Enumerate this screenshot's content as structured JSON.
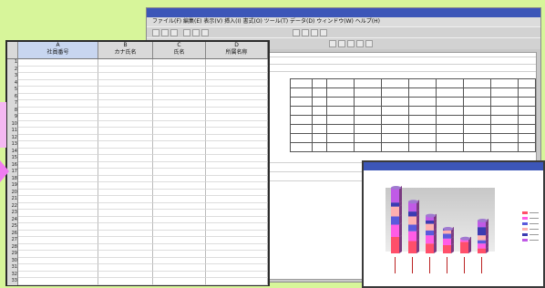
{
  "background_color": "#d7f59a",
  "back_window": {
    "menu_text": "ファイル(F) 編集(E) 表示(V) 挿入(I) 書式(O) ツール(T) データ(D) ウィンドウ(W) ヘルプ(H)"
  },
  "front_sheet": {
    "columns": [
      {
        "letter": "A",
        "header": "社員番号"
      },
      {
        "letter": "B",
        "header": "カナ氏名"
      },
      {
        "letter": "C",
        "header": "氏名"
      },
      {
        "letter": "D",
        "header": "所属名称"
      }
    ],
    "row_numbers": [
      "1",
      "2",
      "3",
      "4",
      "5",
      "6",
      "7",
      "8",
      "9",
      "10",
      "11",
      "12",
      "13",
      "14",
      "15",
      "16",
      "17",
      "18",
      "19",
      "20",
      "21",
      "22",
      "23",
      "24",
      "25",
      "26",
      "27",
      "28",
      "29",
      "30",
      "31",
      "32",
      "33"
    ]
  },
  "chart": {
    "type": "bar",
    "series_colors": [
      "#ff4f6a",
      "#ff5ce6",
      "#5a5adc",
      "#ffb0b0",
      "#3b3bb2",
      "#c05ae6"
    ],
    "stack_values": [
      [
        20,
        15,
        10,
        12,
        5,
        18
      ],
      [
        15,
        12,
        8,
        10,
        6,
        12
      ],
      [
        12,
        10,
        6,
        8,
        4,
        6
      ],
      [
        10,
        8,
        6,
        4,
        2,
        0
      ],
      [
        14,
        4,
        0,
        0,
        0,
        0
      ],
      [
        6,
        6,
        4,
        6,
        10,
        8
      ]
    ]
  }
}
